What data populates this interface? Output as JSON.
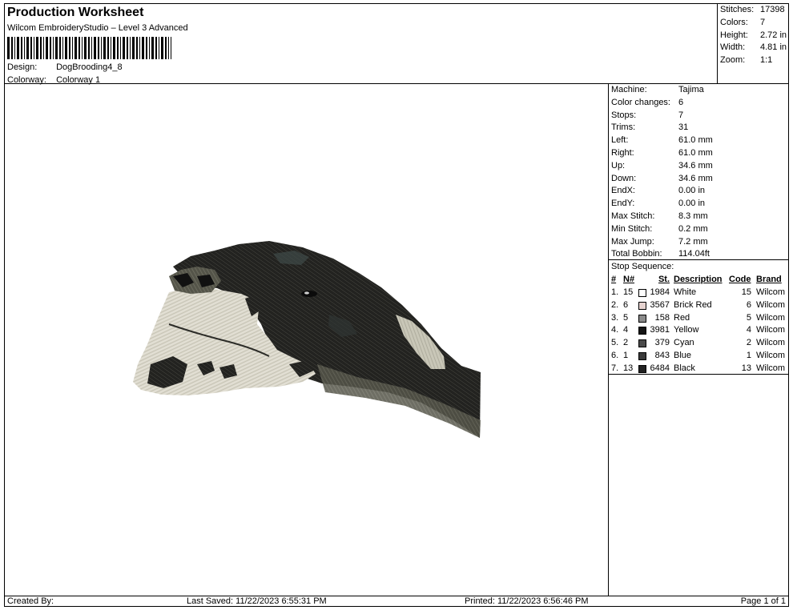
{
  "header": {
    "title": "Production Worksheet",
    "software": "Wilcom EmbroideryStudio – Level 3 Advanced",
    "design_label": "Design:",
    "design_value": "DogBrooding4_8",
    "colorway_label": "Colorway:",
    "colorway_value": "Colorway 1"
  },
  "summary": [
    {
      "label": "Stitches:",
      "value": "17398"
    },
    {
      "label": "Colors:",
      "value": "7"
    },
    {
      "label": "Height:",
      "value": "2.72 in"
    },
    {
      "label": "Width:",
      "value": "4.81 in"
    },
    {
      "label": "Zoom:",
      "value": "1:1"
    }
  ],
  "info": [
    {
      "label": "Machine:",
      "value": "Tajima"
    },
    {
      "label": "Color changes:",
      "value": "6"
    },
    {
      "label": "Stops:",
      "value": "7"
    },
    {
      "label": "Trims:",
      "value": "31"
    },
    {
      "label": "Left:",
      "value": "61.0 mm"
    },
    {
      "label": "Right:",
      "value": "61.0 mm"
    },
    {
      "label": "Up:",
      "value": "34.6 mm"
    },
    {
      "label": "Down:",
      "value": "34.6 mm"
    },
    {
      "label": "EndX:",
      "value": "0.00 in"
    },
    {
      "label": "EndY:",
      "value": "0.00 in"
    },
    {
      "label": "Max Stitch:",
      "value": "8.3 mm"
    },
    {
      "label": "Min Stitch:",
      "value": "0.2 mm"
    },
    {
      "label": "Max Jump:",
      "value": "7.2 mm"
    },
    {
      "label": "Total Bobbin:",
      "value": "114.04ft"
    }
  ],
  "stop_sequence": {
    "title": "Stop Sequence:",
    "columns": {
      "num": "#",
      "n": "N#",
      "st": "St.",
      "description": "Description",
      "code": "Code",
      "brand": "Brand"
    },
    "rows": [
      {
        "num": "1.",
        "n": "15",
        "swatch": "#ffffff",
        "st": "1984",
        "description": "White",
        "code": "15",
        "brand": "Wilcom"
      },
      {
        "num": "2.",
        "n": "6",
        "swatch": "#e6d3d0",
        "st": "3567",
        "description": "Brick Red",
        "code": "6",
        "brand": "Wilcom"
      },
      {
        "num": "3.",
        "n": "5",
        "swatch": "#8a8a8a",
        "st": "158",
        "description": "Red",
        "code": "5",
        "brand": "Wilcom"
      },
      {
        "num": "4.",
        "n": "4",
        "swatch": "#151515",
        "st": "3981",
        "description": "Yellow",
        "code": "4",
        "brand": "Wilcom"
      },
      {
        "num": "5.",
        "n": "2",
        "swatch": "#4a4a4a",
        "st": "379",
        "description": "Cyan",
        "code": "2",
        "brand": "Wilcom"
      },
      {
        "num": "6.",
        "n": "1",
        "swatch": "#3a3a3a",
        "st": "843",
        "description": "Blue",
        "code": "1",
        "brand": "Wilcom"
      },
      {
        "num": "7.",
        "n": "13",
        "swatch": "#222222",
        "st": "6484",
        "description": "Black",
        "code": "13",
        "brand": "Wilcom"
      }
    ]
  },
  "footer": {
    "created": "Created By:",
    "saved": "Last Saved: 11/22/2023 6:55:31 PM",
    "printed": "Printed: 11/22/2023 6:56:46 PM",
    "page": "Page 1 of 1"
  }
}
